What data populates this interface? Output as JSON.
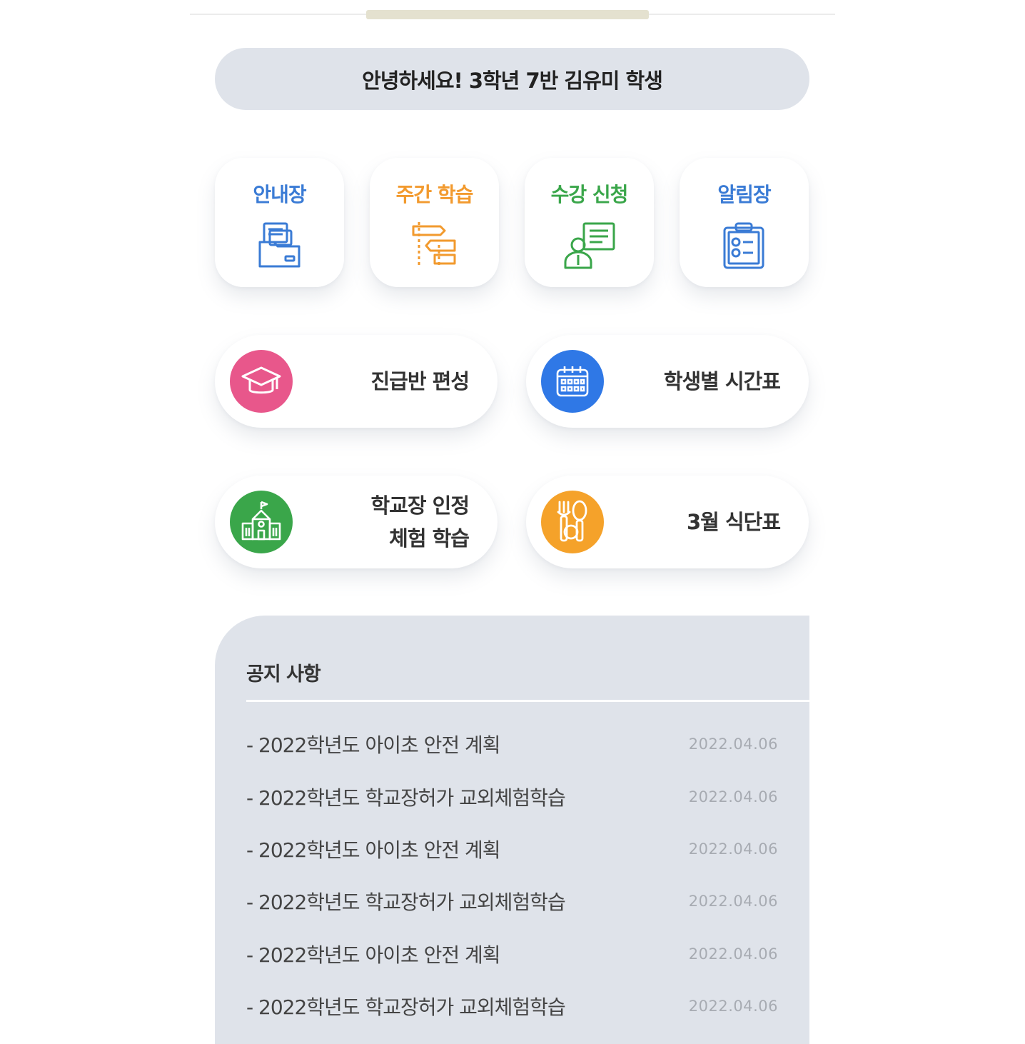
{
  "greeting": "안녕하세요! 3학년 7반 김유미 학생",
  "tiles": [
    {
      "label": "안내장",
      "icon": "folder-documents-icon",
      "color": "#3a7bd5"
    },
    {
      "label": "주간 학습",
      "icon": "signpost-icon",
      "color": "#f29a2e"
    },
    {
      "label": "수강 신청",
      "icon": "presenter-board-icon",
      "color": "#3aa64a"
    },
    {
      "label": "알림장",
      "icon": "clipboard-checklist-icon",
      "color": "#3a7bd5"
    }
  ],
  "pills": [
    {
      "label": "진급반 편성",
      "icon": "graduation-cap-icon",
      "color": "#e8578b"
    },
    {
      "label": "학생별 시간표",
      "icon": "calendar-icon",
      "color": "#2f78e6"
    },
    {
      "label_lines": [
        "학교장 인정",
        "체험 학습"
      ],
      "icon": "school-building-icon",
      "color": "#3aa64a"
    },
    {
      "label": "3월 식단표",
      "icon": "fork-spoon-icon",
      "color": "#f5a22a"
    }
  ],
  "notice": {
    "title": "공지 사항",
    "items": [
      {
        "title": "- 2022학년도 아이초 안전 계획",
        "date": "2022.04.06"
      },
      {
        "title": "- 2022학년도 학교장허가 교외체험학습",
        "date": "2022.04.06"
      },
      {
        "title": "- 2022학년도 아이초 안전 계획",
        "date": "2022.04.06"
      },
      {
        "title": "- 2022학년도 학교장허가 교외체험학습",
        "date": "2022.04.06"
      },
      {
        "title": "- 2022학년도 아이초 안전 계획",
        "date": "2022.04.06"
      },
      {
        "title": "- 2022학년도 학교장허가 교외체험학습",
        "date": "2022.04.06"
      }
    ]
  }
}
